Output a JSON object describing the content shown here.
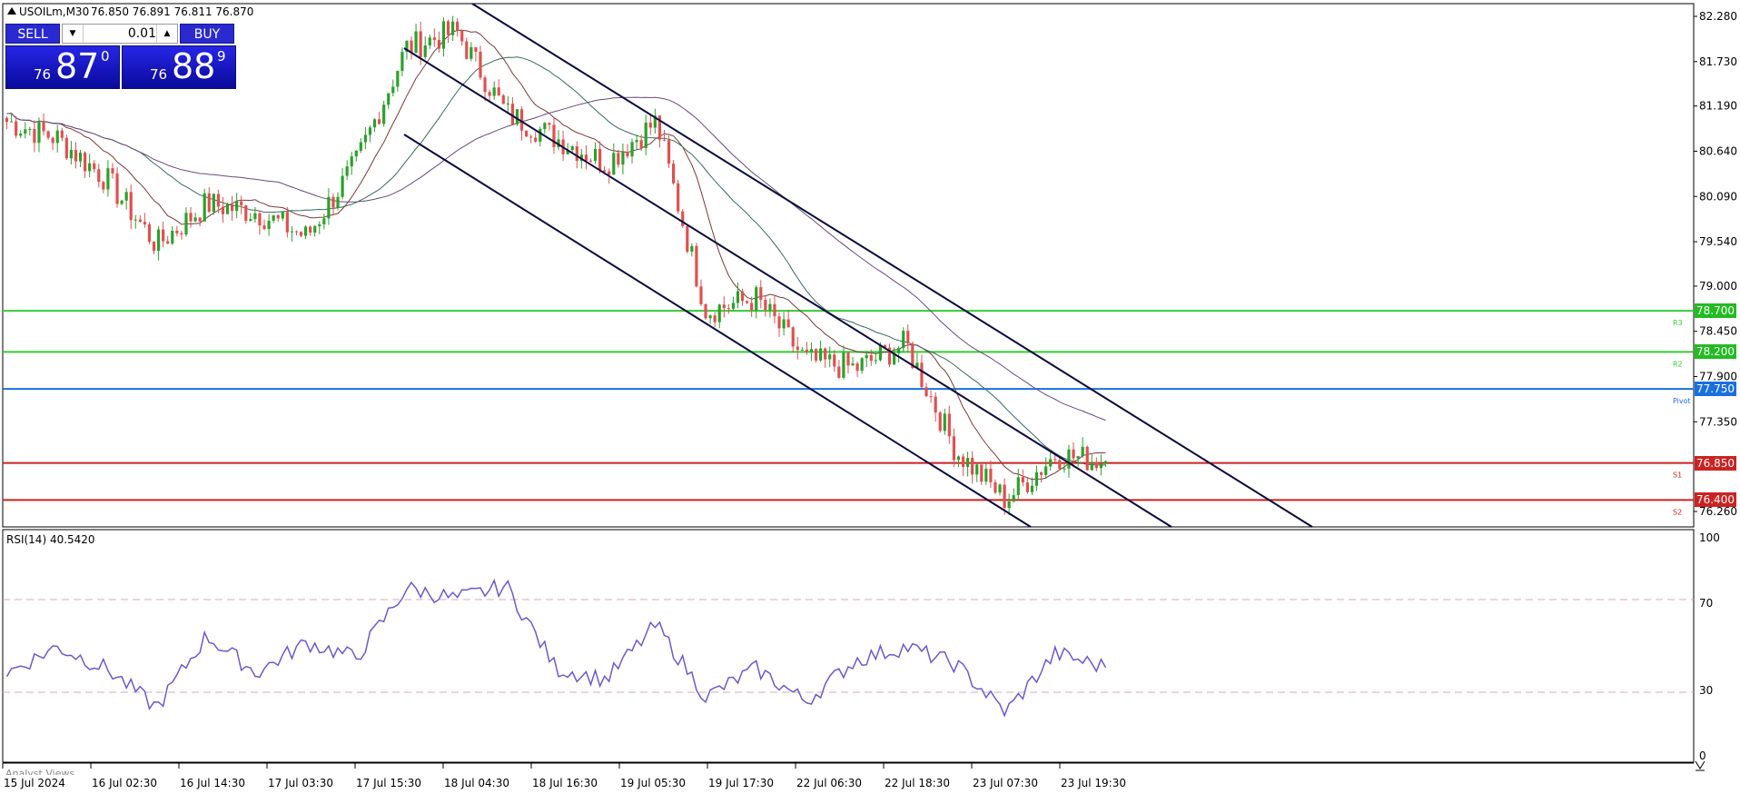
{
  "header": {
    "symbol_label": "USOILm,M30",
    "ohlc": "76.850 76.891 76.811 76.870"
  },
  "trade_panel": {
    "sell_label": "SELL",
    "buy_label": "BUY",
    "lot_value": "0.01",
    "sell_prefix": "76",
    "sell_big": "87",
    "sell_sup": "0",
    "buy_prefix": "76",
    "buy_big": "88",
    "buy_sup": "9"
  },
  "price_axis": {
    "labels": [
      "82.280",
      "81.730",
      "81.190",
      "80.640",
      "80.090",
      "79.540",
      "79.000",
      "78.450",
      "77.900",
      "77.350",
      "76.260"
    ],
    "label_prices": [
      82.28,
      81.73,
      81.19,
      80.64,
      80.09,
      79.54,
      79.0,
      78.45,
      77.9,
      77.35,
      76.26
    ]
  },
  "levels": [
    {
      "name": "R3",
      "price": 78.7,
      "tag": "78.700",
      "color": "#33cc33",
      "label": "R3"
    },
    {
      "name": "R2",
      "price": 78.2,
      "tag": "78.200",
      "color": "#33cc33",
      "label": "R2"
    },
    {
      "name": "Pivot",
      "price": 77.75,
      "tag": "77.750",
      "color": "#1a6fe0",
      "label": "Pivot"
    },
    {
      "name": "S1",
      "price": 76.85,
      "tag": "76.850",
      "color": "#cc2222",
      "label": "S1"
    },
    {
      "name": "S2",
      "price": 76.4,
      "tag": "76.400",
      "color": "#cc2222",
      "label": "S2"
    }
  ],
  "time_axis": {
    "labels": [
      "15 Jul 2024",
      "16 Jul 02:30",
      "16 Jul 14:30",
      "17 Jul 03:30",
      "17 Jul 15:30",
      "18 Jul 04:30",
      "18 Jul 16:30",
      "19 Jul 05:30",
      "19 Jul 17:30",
      "22 Jul 06:30",
      "22 Jul 18:30",
      "23 Jul 07:30",
      "23 Jul 19:30"
    ]
  },
  "rsi": {
    "label": "RSI(14) 40.5420",
    "axis_labels": [
      "100",
      "70",
      "30",
      "0"
    ],
    "axis_values": [
      100,
      70,
      30,
      0
    ]
  },
  "analyst_tab": "Analyst Views",
  "colors": {
    "bull": "#2ca02c",
    "bear": "#e05050",
    "channel": "#0a0a40",
    "rsi_line": "#6a5acd",
    "ma_fast": "#7a3a3a",
    "ma_mid": "#3a6a5a",
    "ma_slow": "#6a4a7a"
  },
  "chart_data": {
    "type": "candlestick",
    "title": "USOILm,M30",
    "ylim": [
      76.26,
      82.28
    ],
    "x": [
      "15 Jul 2024",
      "16 Jul 02:30",
      "16 Jul 14:30",
      "17 Jul 03:30",
      "17 Jul 15:30",
      "18 Jul 04:30",
      "18 Jul 16:30",
      "19 Jul 05:30",
      "19 Jul 17:30",
      "22 Jul 06:30",
      "22 Jul 18:30",
      "23 Jul 07:30",
      "23 Jul 19:30"
    ],
    "close_path": [
      81.0,
      80.8,
      80.3,
      79.5,
      80.0,
      79.9,
      79.6,
      80.5,
      81.9,
      82.1,
      81.1,
      80.8,
      80.5,
      81.0,
      78.7,
      78.85,
      78.1,
      78.0,
      78.3,
      77.0,
      76.4,
      76.95,
      76.87
    ],
    "rsi_path": [
      38,
      50,
      40,
      22,
      55,
      38,
      52,
      45,
      77,
      72,
      78,
      40,
      35,
      60,
      27,
      40,
      25,
      44,
      50,
      42,
      20,
      47,
      40.54
    ],
    "current_price": 76.87
  }
}
